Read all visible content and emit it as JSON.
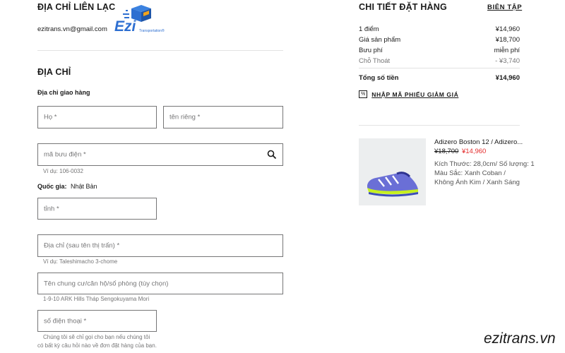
{
  "contact": {
    "title": "ĐỊA CHỈ LIÊN LẠC",
    "email": "ezitrans.vn@gmail.com",
    "logo_word": "Ezi",
    "logo_sub": "Transportation®"
  },
  "address": {
    "title": "ĐỊA CHỈ",
    "shipping_label": "Địa chỉ giao hàng",
    "last_name_placeholder": "Họ *",
    "first_name_placeholder": "tên riêng *",
    "postcode_placeholder": "mã bưu điện *",
    "postcode_hint": "Ví dụ: 106-0032",
    "country_label": "Quốc gia:",
    "country_value": "Nhật Bản",
    "prefecture_placeholder": "tỉnh *",
    "street_placeholder": "Địa chỉ (sau tên thị trấn) *",
    "street_hint": "Ví dụ: Taleshimacho 3-chome",
    "building_placeholder": "Tên chung cư/căn hộ/số phòng (tùy chọn)",
    "building_hint": "1-9-10 ARK Hills Tháp Sengokuyama Mori",
    "phone_placeholder": "số điện thoại *",
    "phone_hint_1": "Chúng tôi sẽ chỉ gọi cho bạn nếu chúng tôi",
    "phone_hint_2": "có bất kỳ câu hỏi nào về đơn đặt hàng của bạn."
  },
  "order": {
    "title": "CHI TIẾT ĐẶT HÀNG",
    "edit_label": "BIÊN TẬP",
    "rows": [
      {
        "label": "1 điểm",
        "value": "¥14,960"
      },
      {
        "label": "Giá sản phẩm",
        "value": "¥18,700"
      },
      {
        "label": "Bưu phí",
        "value": "miễn phí"
      },
      {
        "label": "Chỗ Thoát",
        "value": "- ¥3,740"
      }
    ],
    "total_label": "Tổng số tiền",
    "total_value": "¥14,960",
    "coupon_badge": "%",
    "coupon_label": "NHẬP MÃ PHIẾU GIẢM GIÁ"
  },
  "product": {
    "name": "Adizero Boston 12 / Adizero...",
    "old_price": "¥18,700",
    "new_price": "¥14,960",
    "size_qty": "Kích Thước: 28,0cm/ Số lượng: 1",
    "color_1": "Màu Sắc: Xanh Coban /",
    "color_2": "Không Ánh Kim / Xanh Sáng"
  },
  "watermark": "ezitrans.vn",
  "colors": {
    "logo_blue": "#2e6fd1",
    "logo_orange": "#f2a31b",
    "sale_red": "#e32b2b",
    "input_border": "#767677",
    "hint_gray": "#767677"
  }
}
